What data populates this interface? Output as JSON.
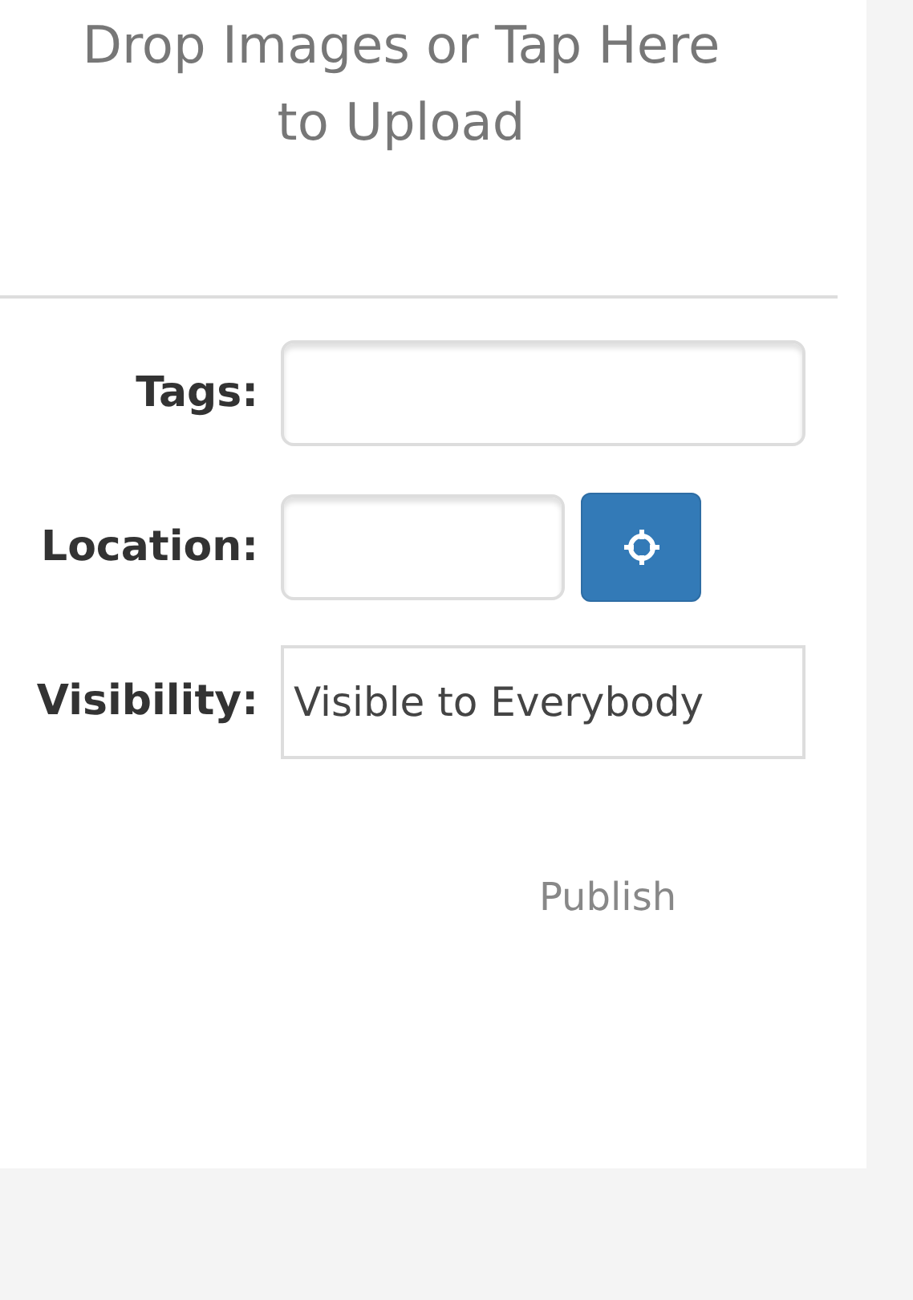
{
  "upload": {
    "lines": [
      "Drop Images or Tap Here",
      "to Upload"
    ]
  },
  "fields": [
    {
      "kind": "text",
      "label": "Tags:"
    },
    {
      "kind": "location",
      "label": "Location:"
    },
    {
      "kind": "select",
      "label": "Visibility:",
      "value": "Visible to Everybody"
    }
  ],
  "publish": "Publish"
}
